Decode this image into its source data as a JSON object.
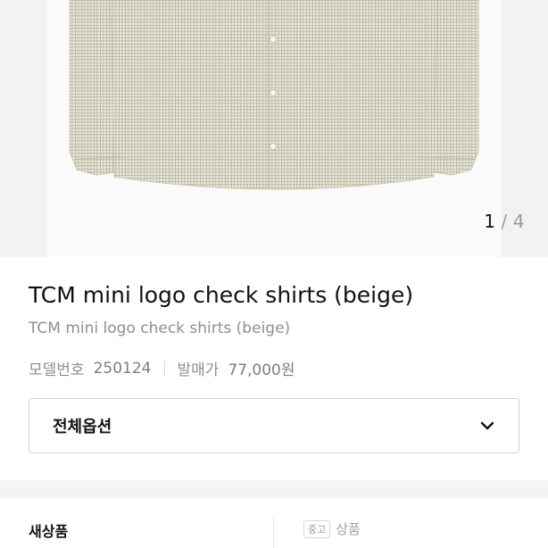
{
  "gallery": {
    "current": "1",
    "separator": "/",
    "total": "4"
  },
  "product": {
    "title": "TCM mini logo check shirts (beige)",
    "subtitle": "TCM mini logo check shirts (beige)",
    "model_label": "모델번호",
    "model_value": "250124",
    "price_label": "발매가",
    "price_value": "77,000원"
  },
  "option": {
    "label": "전체옵션",
    "icon": "chevron-down-icon"
  },
  "condition": {
    "new_label": "새상품",
    "used_badge": "중고",
    "used_label": "상품"
  },
  "colors": {
    "shirt_base": "#e6e4d6",
    "check_line": "#b9b7a3",
    "text_muted": "#8e8e8e"
  }
}
